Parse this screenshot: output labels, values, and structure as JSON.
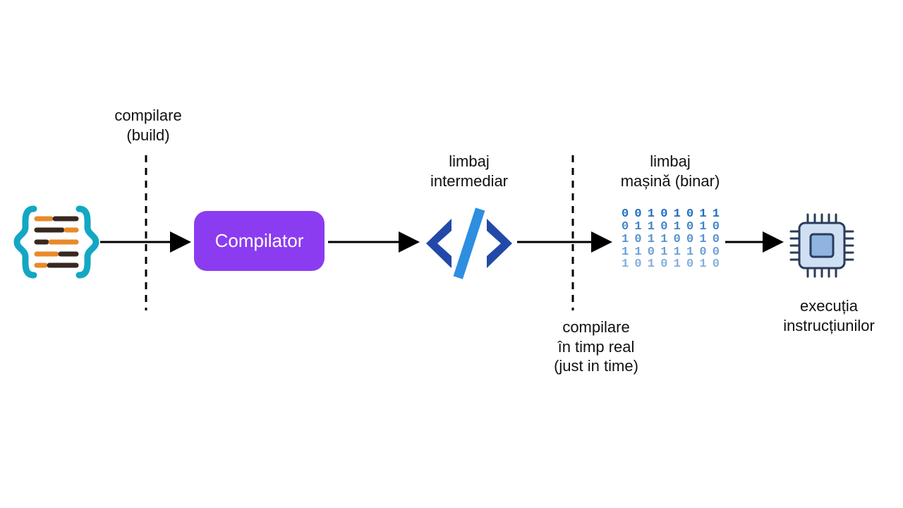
{
  "labels": {
    "compile_build": "compilare\n(build)",
    "compiler": "Compilator",
    "intermediate": "limbaj\nintermediar",
    "jit": "compilare\nîn timp real\n(just in time)",
    "machine": "limbaj\nmașină (binar)",
    "execution": "execuția\ninstrucțiunilor"
  },
  "binary_lines": [
    "0 0 1 0 1 0 1 1",
    "0 1 1 0 1 0 1 0",
    "1 0 1 1 0 0 1 0",
    "1 1 0 1 1  1 0 0",
    "1 0 1 0 1 0 1 0"
  ],
  "colors": {
    "purple": "#8b3cf0",
    "teal": "#13a7c4",
    "blue_dark": "#2349a8",
    "blue_light": "#2e8ee0",
    "orange": "#e98a2a",
    "brown": "#39281f",
    "chip_stroke": "#2a3c5a",
    "chip_fill": "#cfe0f5",
    "chip_core": "#8fb4e0"
  }
}
